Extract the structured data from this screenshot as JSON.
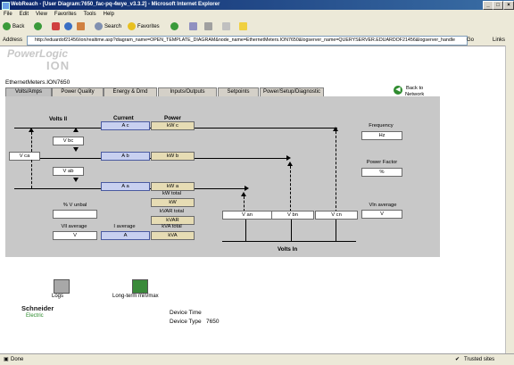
{
  "window": {
    "title": "WebReach - [User Diagram:7650_fac-pq-4wye_v3.3.2] - Microsoft Internet Explorer"
  },
  "menu": [
    "File",
    "Edit",
    "View",
    "Favorites",
    "Tools",
    "Help"
  ],
  "toolbar": {
    "back": "Back",
    "search": "Search",
    "favorites": "Favorites"
  },
  "address": {
    "label": "Address",
    "url": "http://eduardof21456/ion/realtime.asp?diagram_name=OPEN_TEMPLATE_DIAGRAM&node_name=EthernetMeters.ION7650&logserver_name=QUERYSERVER.EDUARDOF21456&logserver_handle",
    "go": "Go",
    "links": "Links"
  },
  "brand": {
    "line1": "PowerLogic",
    "line2": "ION"
  },
  "device": {
    "name": "EthernetMeters.ION7650"
  },
  "back_to_network": {
    "line1": "Back to",
    "line2": "Network"
  },
  "tabs": [
    "Volts/Amps",
    "Power Quality",
    "Energy & Dmd",
    "Inputs/Outputs",
    "Setpoints",
    "Power/Setup/Diagnostic"
  ],
  "diagram": {
    "volts_ll": "Volts ll",
    "current": "Current",
    "power": "Power",
    "ac": "A c",
    "kwc": "kW c",
    "vbc": "V bc",
    "vca": "V ca",
    "ab": "A b",
    "kwb": "kW b",
    "vab": "V ab",
    "aa": "A a",
    "kwa": "kW a",
    "frequency_label": "Frequency",
    "frequency": "Hz",
    "pf_label": "Power Factor",
    "pf": "%",
    "vunbal_label": "% V unbal",
    "vunbal": "",
    "kw_total_label": "kW total",
    "kw_total": "kW",
    "kvar_total_label": "kVAR total",
    "kvar_total": "kVAR",
    "kva_total_label": "kVA total",
    "kva_total": "kVA",
    "vll_avg_label": "Vll average",
    "vll_avg": "V",
    "i_avg_label": "I average",
    "i_avg": "A",
    "van": "V an",
    "vbn": "V bn",
    "vcn": "V cn",
    "vln_avg_label": "Vln average",
    "vln_avg": "V",
    "volts_ln": "Volts ln"
  },
  "links": {
    "logs": "Logs",
    "longterm": "Long-term min/max"
  },
  "footer": {
    "logo1": "Schneider",
    "logo2": "Electric",
    "device_time_label": "Device Time",
    "device_type_label": "Device Type",
    "device_type": "7650"
  },
  "status": {
    "left": "Done",
    "zone": "Trusted sites"
  }
}
